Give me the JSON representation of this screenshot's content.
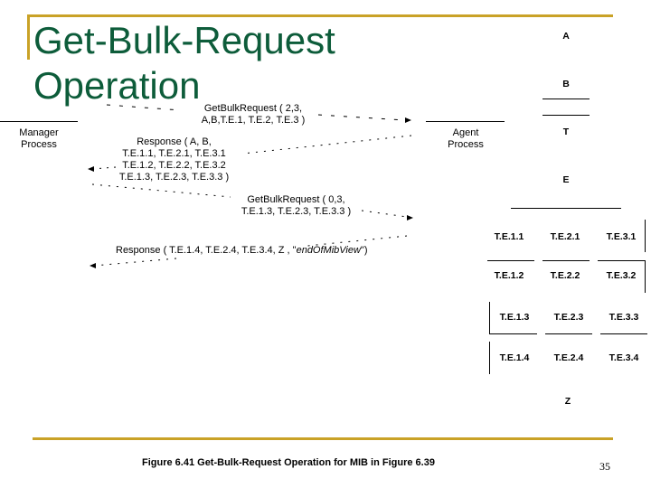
{
  "slide": {
    "title": "Get-Bulk-Request\nOperation",
    "page_number": "35",
    "caption": "Figure 6.41 Get-Bulk-Request Operation for MIB in Figure 6.39",
    "colors": {
      "title": "#0d5c3a",
      "accent_rule": "#c9a227"
    }
  },
  "diagram": {
    "manager_label": "Manager\nProcess",
    "agent_label": "Agent\nProcess",
    "messages": [
      {
        "direction": "manager-to-agent",
        "text": "GetBulkRequest ( 2,3,\nA,B,T.E.1, T.E.2, T.E.3 )"
      },
      {
        "direction": "agent-to-manager",
        "text": "Response ( A, B,\nT.E.1.1, T.E.2.1, T.E.3.1\nT.E.1.2, T.E.2.2, T.E.3.2\nT.E.1.3, T.E.2.3, T.E.3.3 )"
      },
      {
        "direction": "manager-to-agent",
        "text": "GetBulkRequest ( 0,3,\nT.E.1.3, T.E.2.3, T.E.3.3 )"
      },
      {
        "direction": "agent-to-manager",
        "text_prefix": "Response ( T.E.1.4, T.E.2.4, T.E.3.4, Z , \"",
        "text_italic": "endOfMibView",
        "text_suffix": "\")"
      }
    ],
    "mib": {
      "scalars_top": [
        "A",
        "B"
      ],
      "table": "T",
      "entry": "E",
      "rows": [
        [
          "T.E.1.1",
          "T.E.2.1",
          "T.E.3.1"
        ],
        [
          "T.E.1.2",
          "T.E.2.2",
          "T.E.3.2"
        ],
        [
          "T.E.1.3",
          "T.E.2.3",
          "T.E.3.3"
        ],
        [
          "T.E.1.4",
          "T.E.2.4",
          "T.E.3.4"
        ]
      ],
      "scalar_bottom": "Z"
    }
  }
}
